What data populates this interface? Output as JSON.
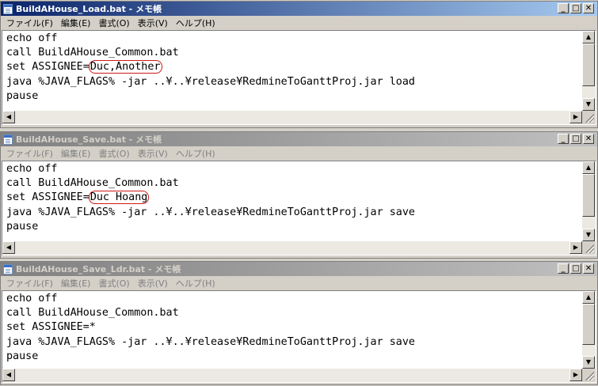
{
  "menu": [
    "ファイル(F)",
    "編集(E)",
    "書式(O)",
    "表示(V)",
    "ヘルプ(H)"
  ],
  "icons": {
    "minimize": "_",
    "maximize": "□",
    "close": "✕",
    "up": "▲",
    "down": "▼",
    "left": "◀",
    "right": "▶"
  },
  "windows": [
    {
      "title": "BuildAHouse_Load.bat - メモ帳",
      "state": "active",
      "lines": [
        "echo off",
        "call BuildAHouse_Common.bat",
        "set ASSIGNEE=",
        "java %JAVA_FLAGS% -jar ..¥..¥release¥RedmineToGanttProj.jar load",
        "pause"
      ],
      "assignee_value": "Duc,Another",
      "highlight_color": "#d01818"
    },
    {
      "title": "BuildAHouse_Save.bat - メモ帳",
      "state": "inactive",
      "lines": [
        "echo off",
        "call BuildAHouse_Common.bat",
        "set ASSIGNEE=",
        "java %JAVA_FLAGS% -jar ..¥..¥release¥RedmineToGanttProj.jar save",
        "pause"
      ],
      "assignee_value": "Duc Hoang",
      "highlight_color": "#d01818"
    },
    {
      "title": "BuildAHouse_Save_Ldr.bat - メモ帳",
      "state": "inactive",
      "lines": [
        "echo off",
        "call BuildAHouse_Common.bat",
        "set ASSIGNEE=*",
        "java %JAVA_FLAGS% -jar ..¥..¥release¥RedmineToGanttProj.jar save",
        "pause"
      ]
    }
  ]
}
